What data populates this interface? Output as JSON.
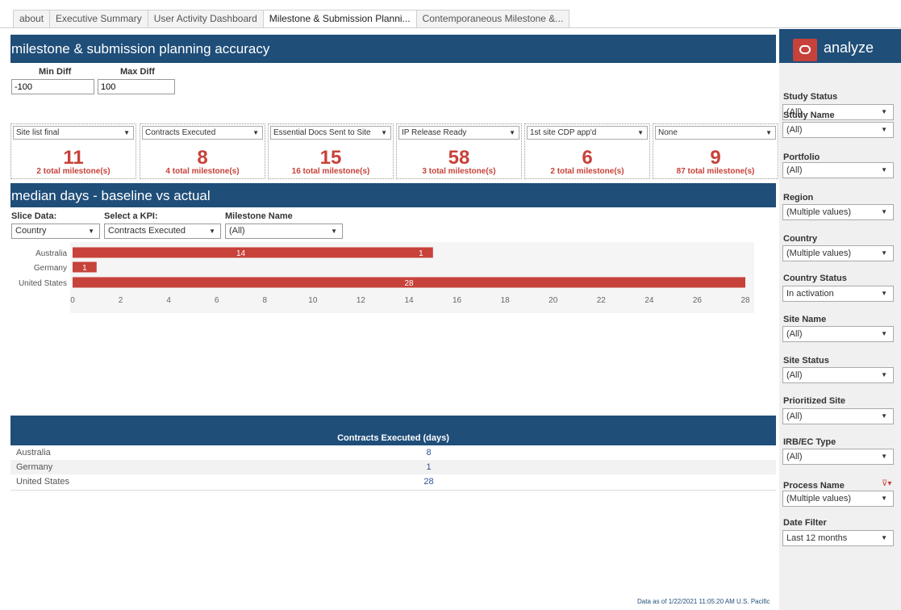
{
  "tabs": [
    {
      "label": "about"
    },
    {
      "label": "Executive Summary"
    },
    {
      "label": "User Activity Dashboard"
    },
    {
      "label": "Milestone & Submission Planni..."
    },
    {
      "label": "Contemporaneous Milestone &..."
    }
  ],
  "section1": {
    "title": "milestone & submission planning accuracy",
    "min_diff_label": "Min Diff",
    "min_diff_value": "-100",
    "max_diff_label": "Max Diff",
    "max_diff_value": "100"
  },
  "cards": [
    {
      "selector": "Site list final",
      "value": "11",
      "subtitle": "2 total milestone(s)"
    },
    {
      "selector": "Contracts Executed",
      "value": "8",
      "subtitle": "4 total milestone(s)"
    },
    {
      "selector": "Essential Docs Sent to Site",
      "value": "15",
      "subtitle": "16 total milestone(s)"
    },
    {
      "selector": "IP Release Ready",
      "value": "58",
      "subtitle": "3 total milestone(s)"
    },
    {
      "selector": "1st site CDP app'd",
      "value": "6",
      "subtitle": "2 total milestone(s)"
    },
    {
      "selector": "None",
      "value": "9",
      "subtitle": "87 total milestone(s)"
    }
  ],
  "section2": {
    "title": "median days - baseline vs actual",
    "slice_label": "Slice Data:",
    "slice_value": "Country",
    "kpi_label": "Select a KPI:",
    "kpi_value": "Contracts Executed",
    "milestone_label": "Milestone Name",
    "milestone_value": "(All)"
  },
  "chart_data": {
    "type": "bar",
    "orientation": "horizontal",
    "categories": [
      "Australia",
      "Germany",
      "United States"
    ],
    "series": [
      {
        "values": [
          14,
          1,
          28
        ]
      },
      {
        "values": [
          1,
          null,
          null
        ]
      }
    ],
    "bar_extents": [
      15,
      1,
      28
    ],
    "xlim": [
      0,
      28
    ],
    "x_ticks": [
      0,
      2,
      4,
      6,
      8,
      10,
      12,
      14,
      16,
      18,
      20,
      22,
      24,
      26,
      28
    ],
    "color": "#c7423a"
  },
  "table": {
    "column": "Contracts Executed (days)",
    "rows": [
      {
        "name": "Australia",
        "value": "8"
      },
      {
        "name": "Germany",
        "value": "1"
      },
      {
        "name": "United States",
        "value": "28"
      }
    ]
  },
  "footnote": "Data as of 1/22/2021 11:05:20 AM U.S. Pacific",
  "sidebar": {
    "brand": "analyze",
    "filters": [
      {
        "label": "Study Status",
        "value": "(All)"
      },
      {
        "label": "Study Name",
        "value": "(All)"
      },
      {
        "label": "Portfolio",
        "value": "(All)"
      },
      {
        "label": "Region",
        "value": "(Multiple values)"
      },
      {
        "label": "Country",
        "value": "(Multiple values)"
      },
      {
        "label": "Country Status",
        "value": "In activation"
      },
      {
        "label": "Site Name",
        "value": "(All)"
      },
      {
        "label": "Site Status",
        "value": "(All)"
      },
      {
        "label": "Prioritized Site",
        "value": "(All)"
      },
      {
        "label": "IRB/EC Type",
        "value": "(All)"
      },
      {
        "label": "Process Name",
        "value": "(Multiple values)"
      },
      {
        "label": "Date Filter",
        "value": "Last 12 months"
      }
    ]
  },
  "colors": {
    "band": "#1f4e79",
    "accent": "#c7423a",
    "sidebar_bg": "#f0f0f0"
  }
}
